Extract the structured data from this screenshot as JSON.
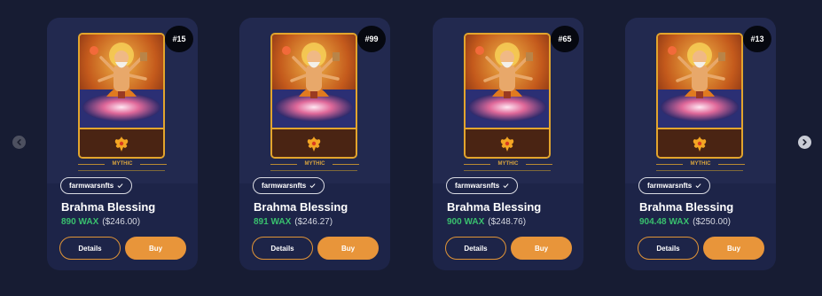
{
  "colors": {
    "background": "#171c33",
    "card": "#1d2448",
    "accent": "#e8953a",
    "price_wax": "#39c06e",
    "frame_gold": "#e3a52d"
  },
  "navigation": {
    "prev_icon": "chevron-left-icon",
    "next_icon": "chevron-right-icon"
  },
  "cards": [
    {
      "badge": "#15",
      "rarity": "MYTHIC",
      "collection": "farmwarsnfts",
      "verified_icon": "checkmark-icon",
      "title": "Brahma Blessing",
      "price_wax": "890 WAX",
      "price_usd": "($246.00)",
      "details_label": "Details",
      "buy_label": "Buy"
    },
    {
      "badge": "#99",
      "rarity": "MYTHIC",
      "collection": "farmwarsnfts",
      "verified_icon": "checkmark-icon",
      "title": "Brahma Blessing",
      "price_wax": "891 WAX",
      "price_usd": "($246.27)",
      "details_label": "Details",
      "buy_label": "Buy"
    },
    {
      "badge": "#65",
      "rarity": "MYTHIC",
      "collection": "farmwarsnfts",
      "verified_icon": "checkmark-icon",
      "title": "Brahma Blessing",
      "price_wax": "900 WAX",
      "price_usd": "($248.76)",
      "details_label": "Details",
      "buy_label": "Buy"
    },
    {
      "badge": "#13",
      "rarity": "MYTHIC",
      "collection": "farmwarsnfts",
      "verified_icon": "checkmark-icon",
      "title": "Brahma Blessing",
      "price_wax": "904.48 WAX",
      "price_usd": "($250.00)",
      "details_label": "Details",
      "buy_label": "Buy"
    }
  ]
}
